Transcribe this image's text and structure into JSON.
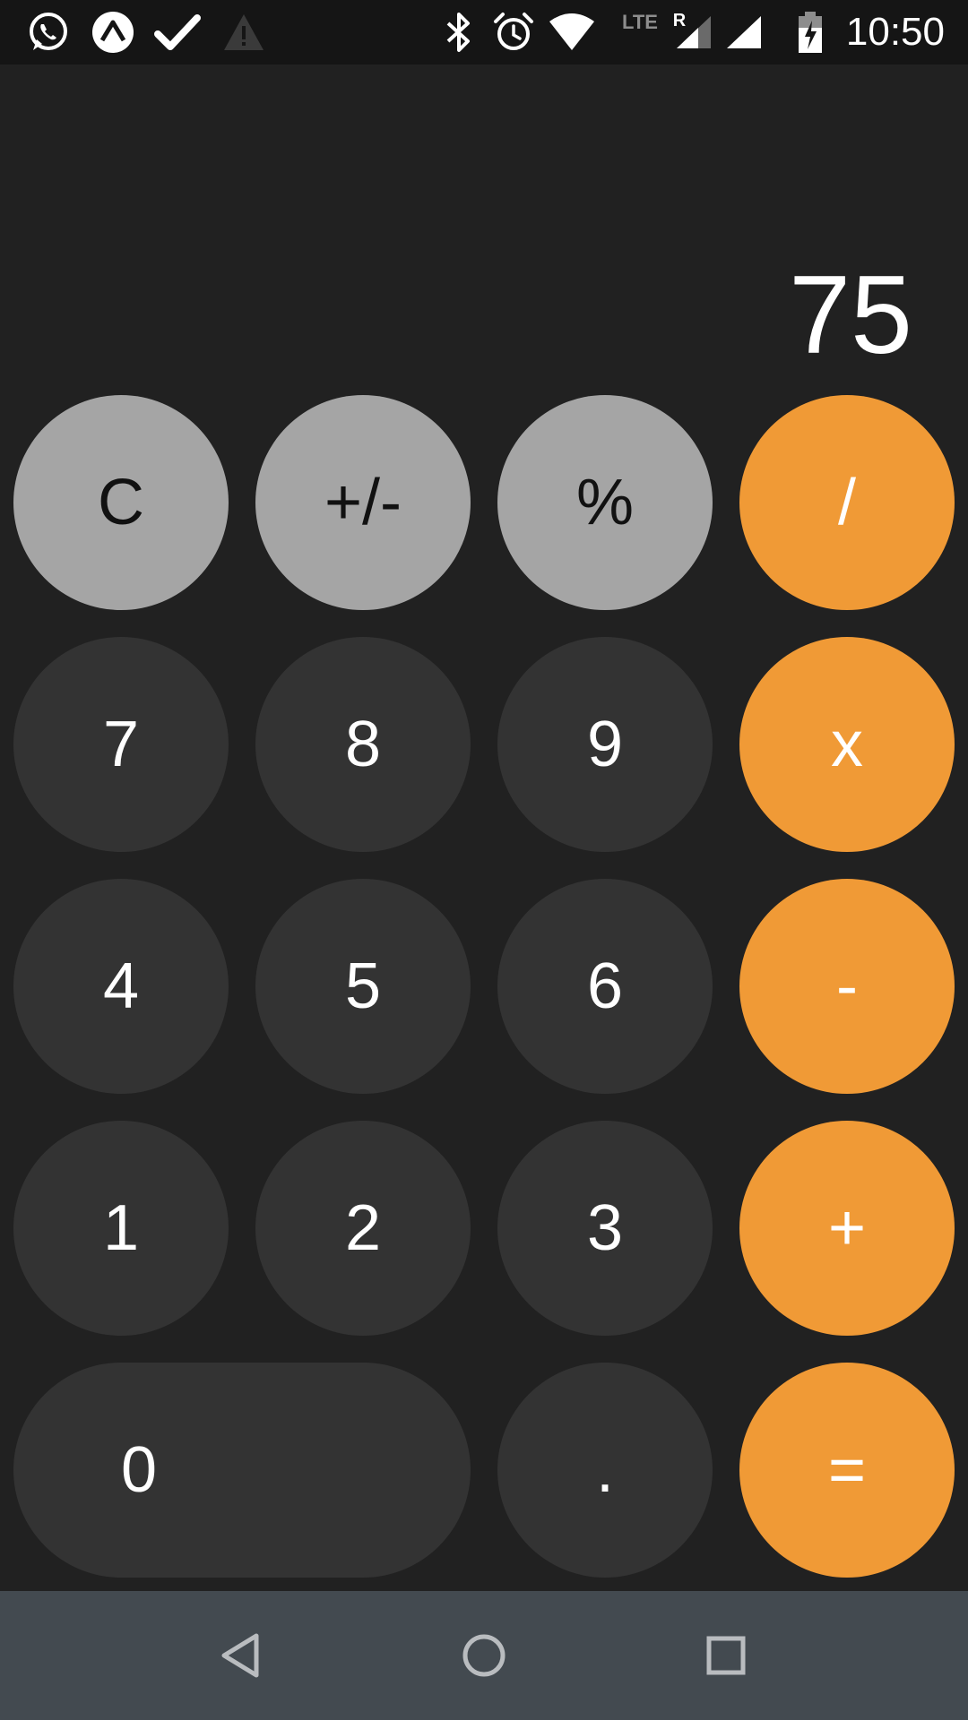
{
  "status_bar": {
    "time": "10:50",
    "network_label": "LTE",
    "roaming_label": "R",
    "icons": [
      "whatsapp-icon",
      "expo-icon",
      "check-icon",
      "warning-icon",
      "bluetooth-icon",
      "alarm-icon",
      "wifi-icon",
      "cell-signal-icon",
      "cell-signal-icon",
      "battery-charging-icon"
    ]
  },
  "display": {
    "value": "75"
  },
  "keypad": {
    "clear": "C",
    "sign": "+/-",
    "percent": "%",
    "divide": "/",
    "seven": "7",
    "eight": "8",
    "nine": "9",
    "multiply": "x",
    "four": "4",
    "five": "5",
    "six": "6",
    "subtract": "-",
    "one": "1",
    "two": "2",
    "three": "3",
    "add": "+",
    "zero": "0",
    "decimal": ".",
    "equals": "="
  },
  "colors": {
    "background": "#212121",
    "function_key": "#a5a5a5",
    "number_key": "#333333",
    "operator_key": "#f09a36",
    "nav_bar": "#434a50"
  },
  "nav_bar": {
    "icons": [
      "back-icon",
      "home-icon",
      "recents-icon"
    ]
  }
}
